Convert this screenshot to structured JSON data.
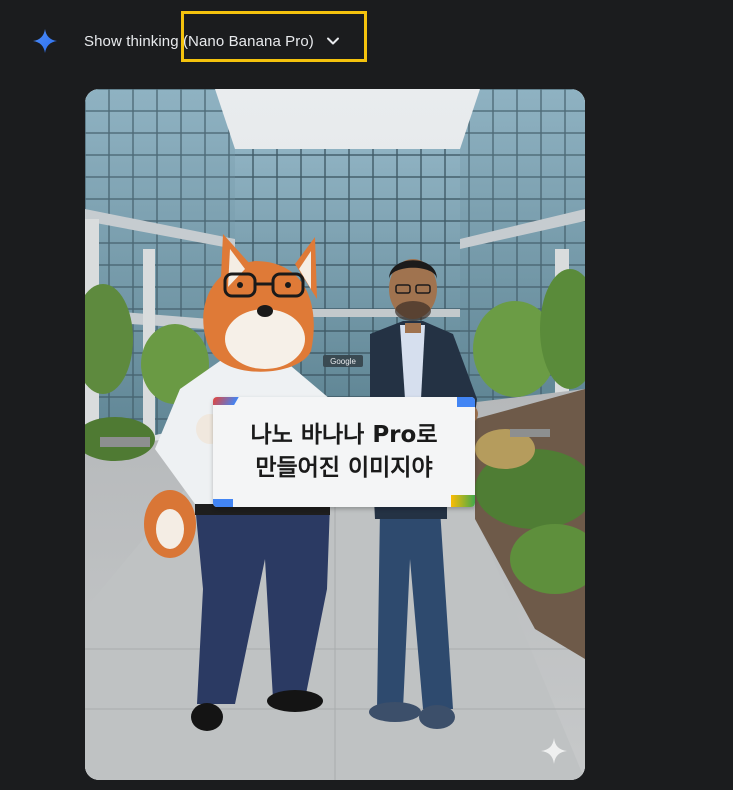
{
  "header": {
    "thinking_label": "Show thinking (Nano Banana Pro)",
    "logo_icon": "gemini-spark-icon",
    "toggle_icon": "chevron-down-icon",
    "highlight_color": "#f4c20d"
  },
  "image": {
    "sign_line_1": "나노 바나나 Pro로",
    "sign_line_2": "만들어진 이미지야",
    "building_sign": "Google",
    "watermark_icon": "sparkle-watermark-icon"
  }
}
